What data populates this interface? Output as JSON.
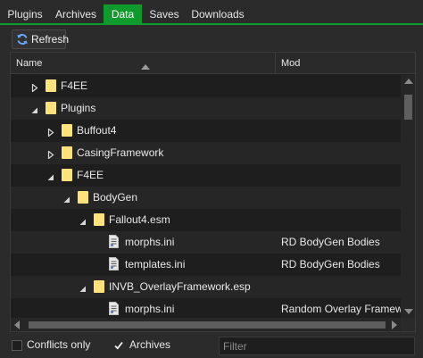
{
  "tabs": [
    {
      "label": "Plugins",
      "active": false
    },
    {
      "label": "Archives",
      "active": false
    },
    {
      "label": "Data",
      "active": true
    },
    {
      "label": "Saves",
      "active": false
    },
    {
      "label": "Downloads",
      "active": false
    }
  ],
  "toolbar": {
    "refresh_label": "Refresh"
  },
  "tree": {
    "columns": {
      "name": "Name",
      "mod": "Mod",
      "sorted_by": "Name",
      "sort_direction": "ascending"
    },
    "rows": [
      {
        "name": "F4EE",
        "mod": "",
        "type": "folder",
        "depth": 1,
        "expanded": false
      },
      {
        "name": "Plugins",
        "mod": "",
        "type": "folder",
        "depth": 1,
        "expanded": true
      },
      {
        "name": "Buffout4",
        "mod": "",
        "type": "folder",
        "depth": 2,
        "expanded": false
      },
      {
        "name": "CasingFramework",
        "mod": "",
        "type": "folder",
        "depth": 2,
        "expanded": false
      },
      {
        "name": "F4EE",
        "mod": "",
        "type": "folder",
        "depth": 2,
        "expanded": true
      },
      {
        "name": "BodyGen",
        "mod": "",
        "type": "folder",
        "depth": 3,
        "expanded": true
      },
      {
        "name": "Fallout4.esm",
        "mod": "",
        "type": "folder",
        "depth": 4,
        "expanded": true
      },
      {
        "name": "morphs.ini",
        "mod": "RD BodyGen Bodies",
        "type": "file",
        "depth": 5
      },
      {
        "name": "templates.ini",
        "mod": "RD BodyGen Bodies",
        "type": "file",
        "depth": 5
      },
      {
        "name": "INVB_OverlayFramework.esp",
        "mod": "",
        "type": "folder",
        "depth": 4,
        "expanded": true
      },
      {
        "name": "morphs.ini",
        "mod": "Random Overlay Framework",
        "type": "file",
        "depth": 5
      }
    ]
  },
  "footer": {
    "conflicts_only": {
      "label": "Conflicts only",
      "checked": false
    },
    "archives": {
      "label": "Archives",
      "checked": true
    },
    "filter": {
      "placeholder": "Filter",
      "value": ""
    }
  },
  "colors": {
    "accent": "#0f9b2c",
    "folder": "#ffe27a",
    "background": "#2b2b2b",
    "panel": "#1e1e1e"
  }
}
